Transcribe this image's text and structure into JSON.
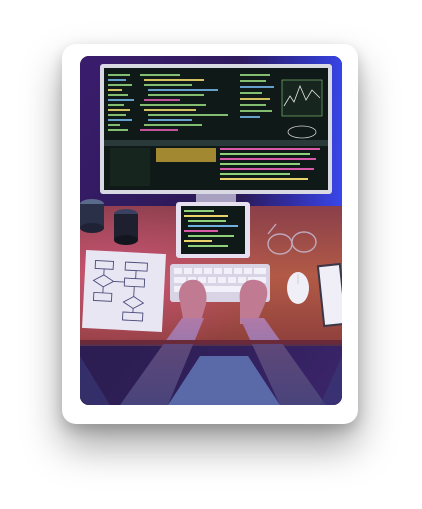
{
  "image": {
    "alt": "",
    "subject": "developer-desk-photo",
    "colors": {
      "ambient_purple": "#5a2a9c",
      "ambient_blue": "#2a3cff",
      "desk_wood": "#b25a46",
      "monitor_screen": "#0f1a18",
      "code_green": "#8fd07a",
      "code_yellow": "#e8d36a",
      "code_pink": "#d85aa8",
      "shirt_blue": "#8a96c8",
      "paper": "#e9e6f3"
    }
  }
}
